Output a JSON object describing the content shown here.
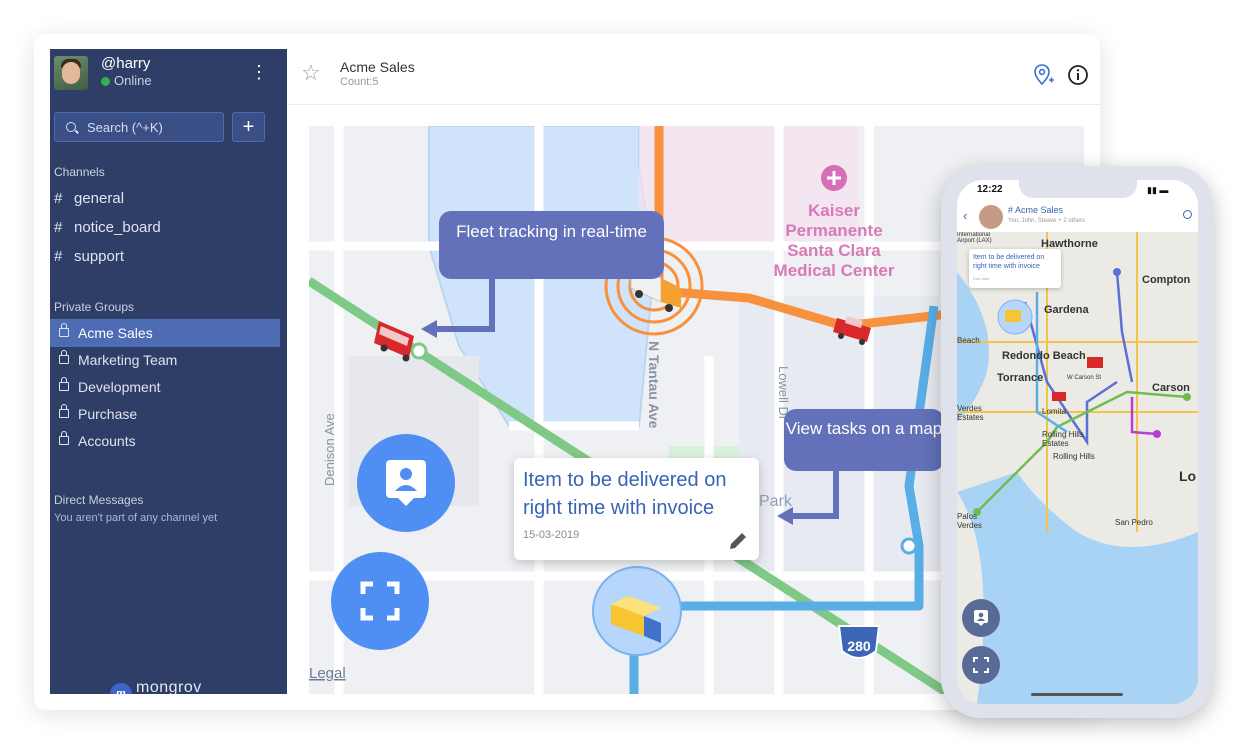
{
  "user": {
    "handle": "@harry",
    "status": "Online"
  },
  "search": {
    "placeholder": "Search (^+K)",
    "add_label": "+"
  },
  "channels": {
    "title": "Channels",
    "items": [
      "general",
      "notice_board",
      "support"
    ]
  },
  "private_groups": {
    "title": "Private Groups",
    "items": [
      "Acme Sales",
      "Marketing Team",
      "Development",
      "Purchase",
      "Accounts"
    ],
    "active": "Acme Sales"
  },
  "direct_messages": {
    "title": "Direct Messages",
    "note": "You aren't part of any channel yet"
  },
  "brand": {
    "name": "mongrov"
  },
  "header": {
    "title": "Acme Sales",
    "count": "Count:5"
  },
  "map": {
    "callout_fleet": "Fleet tracking in real-time",
    "callout_tasks": "View tasks on a map",
    "task_title": "Item to be delivered on right time with invoice",
    "task_date": "15-03-2019",
    "labels": {
      "hospital_1": "Kaiser",
      "hospital_2": "Permanente",
      "hospital_3": "Santa Clara",
      "hospital_4": "Medical Center",
      "street_1": "N Tantau Ave",
      "street_2": "Lowell Dr",
      "street_3": "Denison Ave",
      "park": "Park",
      "legal": "Legal",
      "highway": "280"
    }
  },
  "phone": {
    "time": "12:22",
    "title": "# Acme Sales",
    "subtitle": "You, John, Steave + 2 others",
    "task_title": "Item to be delivered on right time with invoice",
    "task_date": "Due date",
    "places": [
      "Hawthorne",
      "Gardena",
      "Redondo Beach",
      "Torrance",
      "Lomita",
      "Rolling Hills Estates",
      "Rolling Hills",
      "Compton",
      "Carson",
      "San Pedro",
      "Lo",
      "International Airport (LAX)",
      "Beach",
      "Verdes Estates",
      "W Carson St",
      "Palos Verdes"
    ]
  },
  "colors": {
    "sidebar": "#2f3e66",
    "active": "#4d6cb3",
    "accent": "#4f8ef2",
    "callout": "#6271b9",
    "route_orange": "#f7913d",
    "route_blue": "#5aaee6",
    "route_green": "#7fc986"
  }
}
